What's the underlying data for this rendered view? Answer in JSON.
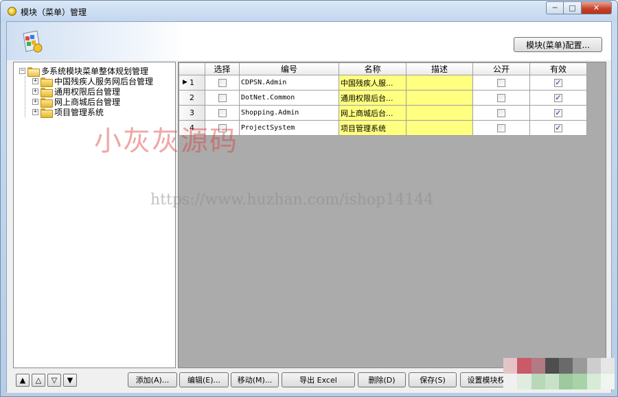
{
  "window": {
    "title": "模块（菜单）管理",
    "controls": {
      "minimize": "─",
      "maximize": "□",
      "close": "✕"
    }
  },
  "header": {
    "config_button": "模块(菜单)配置..."
  },
  "tree": {
    "root": {
      "label": "多系统模块菜单整体规划管理",
      "expanded": true
    },
    "children": [
      {
        "label": "中国残疾人服务网后台管理",
        "expander": "+"
      },
      {
        "label": "通用权限后台管理",
        "expander": "+"
      },
      {
        "label": "网上商城后台管理",
        "expander": "+"
      },
      {
        "label": "项目管理系统",
        "expander": "+"
      }
    ]
  },
  "grid": {
    "columns": [
      "",
      "选择",
      "编号",
      "名称",
      "描述",
      "公开",
      "有效"
    ],
    "rows": [
      {
        "num": "1",
        "current": true,
        "selected": false,
        "code": "CDPSN.Admin",
        "name": "中国残疾人服...",
        "desc": "",
        "public": false,
        "valid": true
      },
      {
        "num": "2",
        "current": false,
        "selected": false,
        "code": "DotNet.Common",
        "name": "通用权限后台...",
        "desc": "",
        "public": false,
        "valid": true
      },
      {
        "num": "3",
        "current": false,
        "selected": false,
        "code": "Shopping.Admin",
        "name": "网上商城后台...",
        "desc": "",
        "public": false,
        "valid": true
      },
      {
        "num": "4",
        "current": false,
        "selected": false,
        "code": "ProjectSystem",
        "name": "项目管理系统",
        "desc": "",
        "public": false,
        "valid": true
      }
    ]
  },
  "bottom": {
    "nav": [
      "▲",
      "△",
      "▽",
      "▼"
    ],
    "buttons": {
      "add": "添加(A)...",
      "edit": "编辑(E)...",
      "move": "移动(M)...",
      "export": "导出 Excel",
      "delete": "删除(D)",
      "save": "保存(S)",
      "set_modules": "设置模块权"
    }
  },
  "watermarks": {
    "red": "小灰灰源码",
    "url": "https://www.huzhan.com/ishop14144"
  },
  "colors": {
    "highlight_cell": "#ffff80",
    "window_frame": "#b7cde6"
  }
}
